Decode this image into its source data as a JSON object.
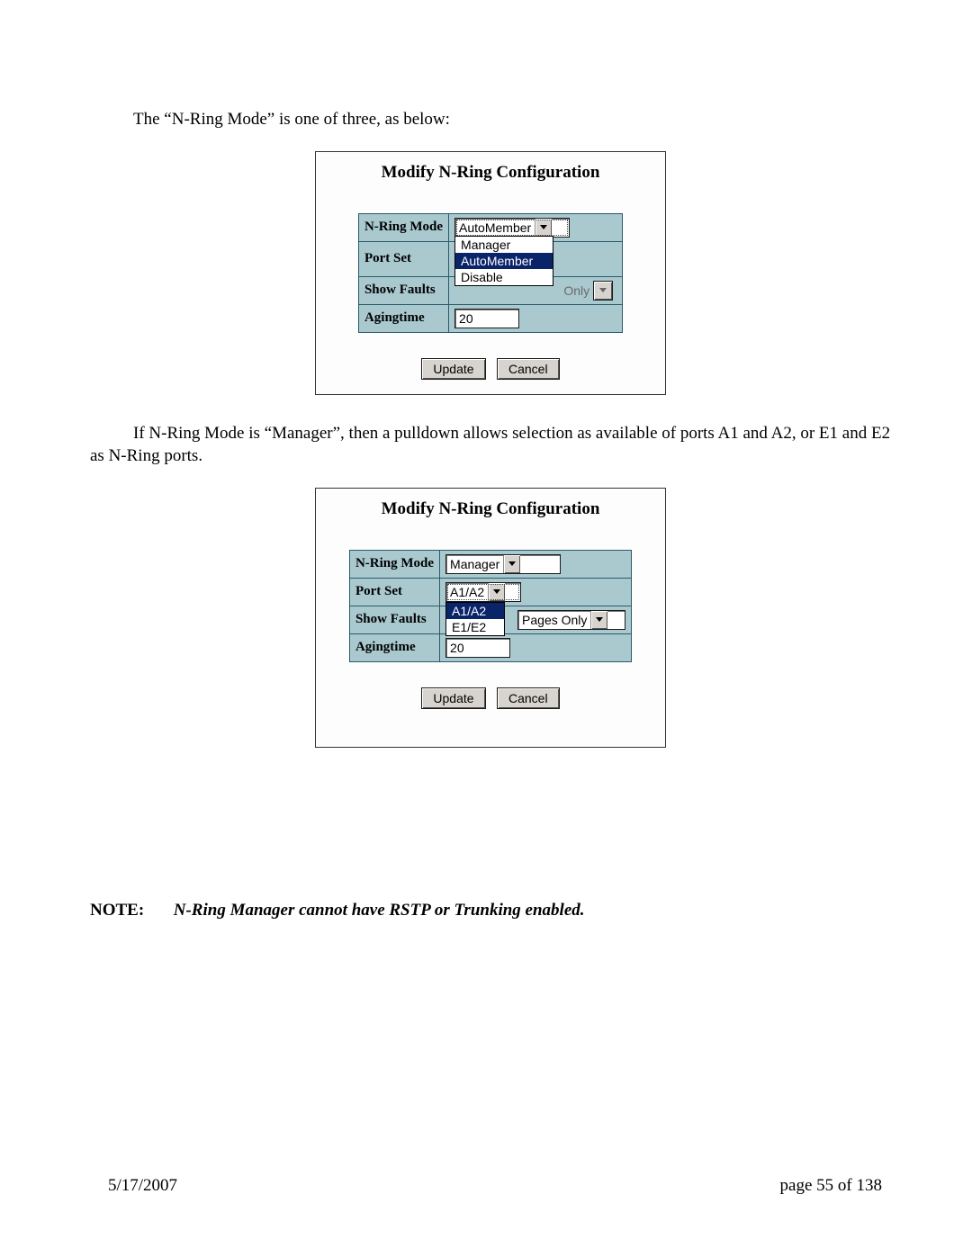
{
  "text": {
    "intro": "The “N-Ring Mode” is one of three, as below:",
    "middle": "If N-Ring Mode is “Manager”, then a pulldown allows selection as available of ports A1 and A2, or E1 and E2 as N-Ring ports.",
    "note_label": "NOTE:",
    "note_text": "N-Ring Manager cannot have RSTP or Trunking enabled."
  },
  "labels": {
    "n_ring_mode": "N-Ring Mode",
    "port_set": "Port Set",
    "show_faults": "Show Faults",
    "agingtime": "Agingtime"
  },
  "panel1": {
    "title": "Modify N-Ring Configuration",
    "mode_value": "AutoMember",
    "mode_options": [
      "Manager",
      "AutoMember",
      "Disable"
    ],
    "mode_highlight": "AutoMember",
    "showfaults_ghost": "Only",
    "aging_value": "20",
    "buttons": {
      "update": "Update",
      "cancel": "Cancel"
    }
  },
  "panel2": {
    "title": "Modify N-Ring Configuration",
    "mode_value": "Manager",
    "portset_value": "A1/A2",
    "portset_options": [
      "A1/A2",
      "E1/E2"
    ],
    "portset_highlight": "A1/A2",
    "showfaults_value": "Pages Only",
    "aging_value": "20",
    "buttons": {
      "update": "Update",
      "cancel": "Cancel"
    }
  },
  "footer": {
    "date": "5/17/2007",
    "page": "page 55 of 138"
  }
}
